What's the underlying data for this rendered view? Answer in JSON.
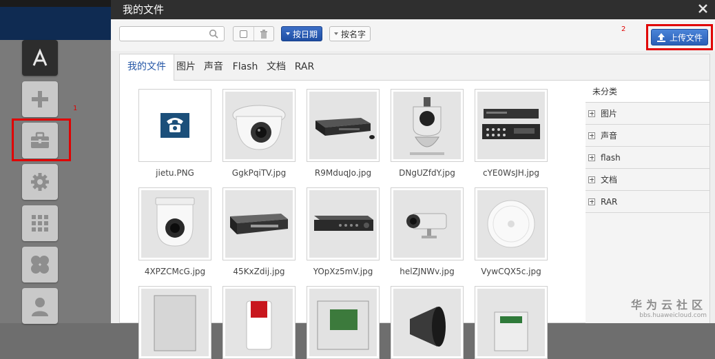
{
  "dialog": {
    "title": "我的文件"
  },
  "toolbar": {
    "search_placeholder": "",
    "search_value": "",
    "sort_by_date": "按日期",
    "sort_by_name": "按名字",
    "upload": "上传文件"
  },
  "annotations": {
    "one": "1",
    "two": "2"
  },
  "tabs": [
    {
      "label": "我的文件",
      "active": true
    },
    {
      "label": "图片"
    },
    {
      "label": "声音"
    },
    {
      "label": "Flash"
    },
    {
      "label": "文档"
    },
    {
      "label": "RAR"
    }
  ],
  "files": [
    {
      "name": "jietu.PNG",
      "icon": "phone-icon"
    },
    {
      "name": "GgkPqiTV.jpg",
      "icon": "dome-camera"
    },
    {
      "name": "R9MduqJo.jpg",
      "icon": "dvr-recorder"
    },
    {
      "name": "DNgUZfdY.jpg",
      "icon": "ptz-camera"
    },
    {
      "name": "cYE0WsJH.jpg",
      "icon": "dvr-front-back"
    },
    {
      "name": "4XPZCMcG.jpg",
      "icon": "dome-camera"
    },
    {
      "name": "45KxZdij.jpg",
      "icon": "dvr-recorder"
    },
    {
      "name": "YOpXz5mV.jpg",
      "icon": "dvr-recorder"
    },
    {
      "name": "helZJNWv.jpg",
      "icon": "bullet-camera"
    },
    {
      "name": "VywCQX5c.jpg",
      "icon": "ceiling-sensor"
    },
    {
      "name": "",
      "icon": "metal-box"
    },
    {
      "name": "",
      "icon": "alarm-siren"
    },
    {
      "name": "",
      "icon": "circuit-box"
    },
    {
      "name": "",
      "icon": "horn-speaker"
    },
    {
      "name": "",
      "icon": "control-panel"
    }
  ],
  "categories": {
    "header": "未分类",
    "items": [
      {
        "label": "图片"
      },
      {
        "label": "声音"
      },
      {
        "label": "flash"
      },
      {
        "label": "文档"
      },
      {
        "label": "RAR"
      }
    ]
  },
  "watermark": {
    "title": "华为云社区",
    "url": "bbs.huaweicloud.com"
  },
  "colors": {
    "accent": "#2456a6",
    "highlight": "#e00000",
    "titlebar": "#2f2f2f"
  }
}
